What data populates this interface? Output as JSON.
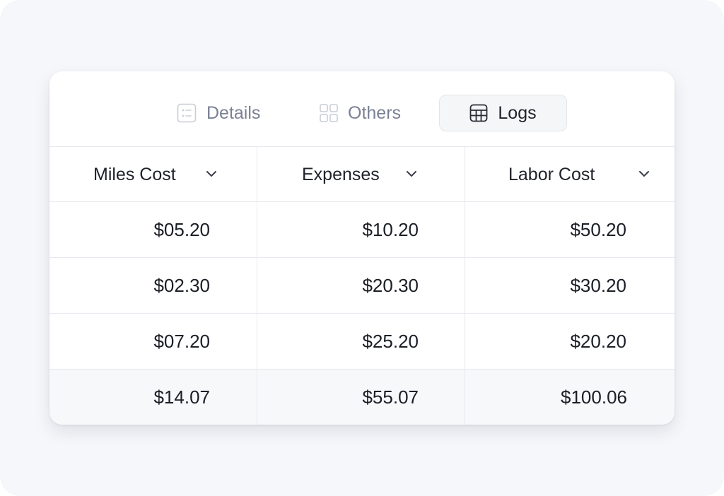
{
  "tabs": [
    {
      "label": "Details",
      "icon": "list-icon",
      "active": false
    },
    {
      "label": "Others",
      "icon": "grid-icon",
      "active": false
    },
    {
      "label": "Logs",
      "icon": "table-icon",
      "active": true
    }
  ],
  "table": {
    "columns": [
      {
        "label": "Miles Cost"
      },
      {
        "label": "Expenses"
      },
      {
        "label": "Labor Cost"
      }
    ],
    "rows": [
      [
        "$05.20",
        "$10.20",
        "$50.20"
      ],
      [
        "$02.30",
        "$20.30",
        "$30.20"
      ],
      [
        "$07.20",
        "$25.20",
        "$20.20"
      ]
    ],
    "totals": [
      "$14.07",
      "$55.07",
      "$100.06"
    ]
  },
  "colors": {
    "background": "#f6f7fb",
    "card": "#ffffff",
    "active_tab_bg": "#f5f6f8",
    "inactive_text": "#7a8194",
    "text": "#1f2229",
    "border": "#e7e9ee"
  }
}
